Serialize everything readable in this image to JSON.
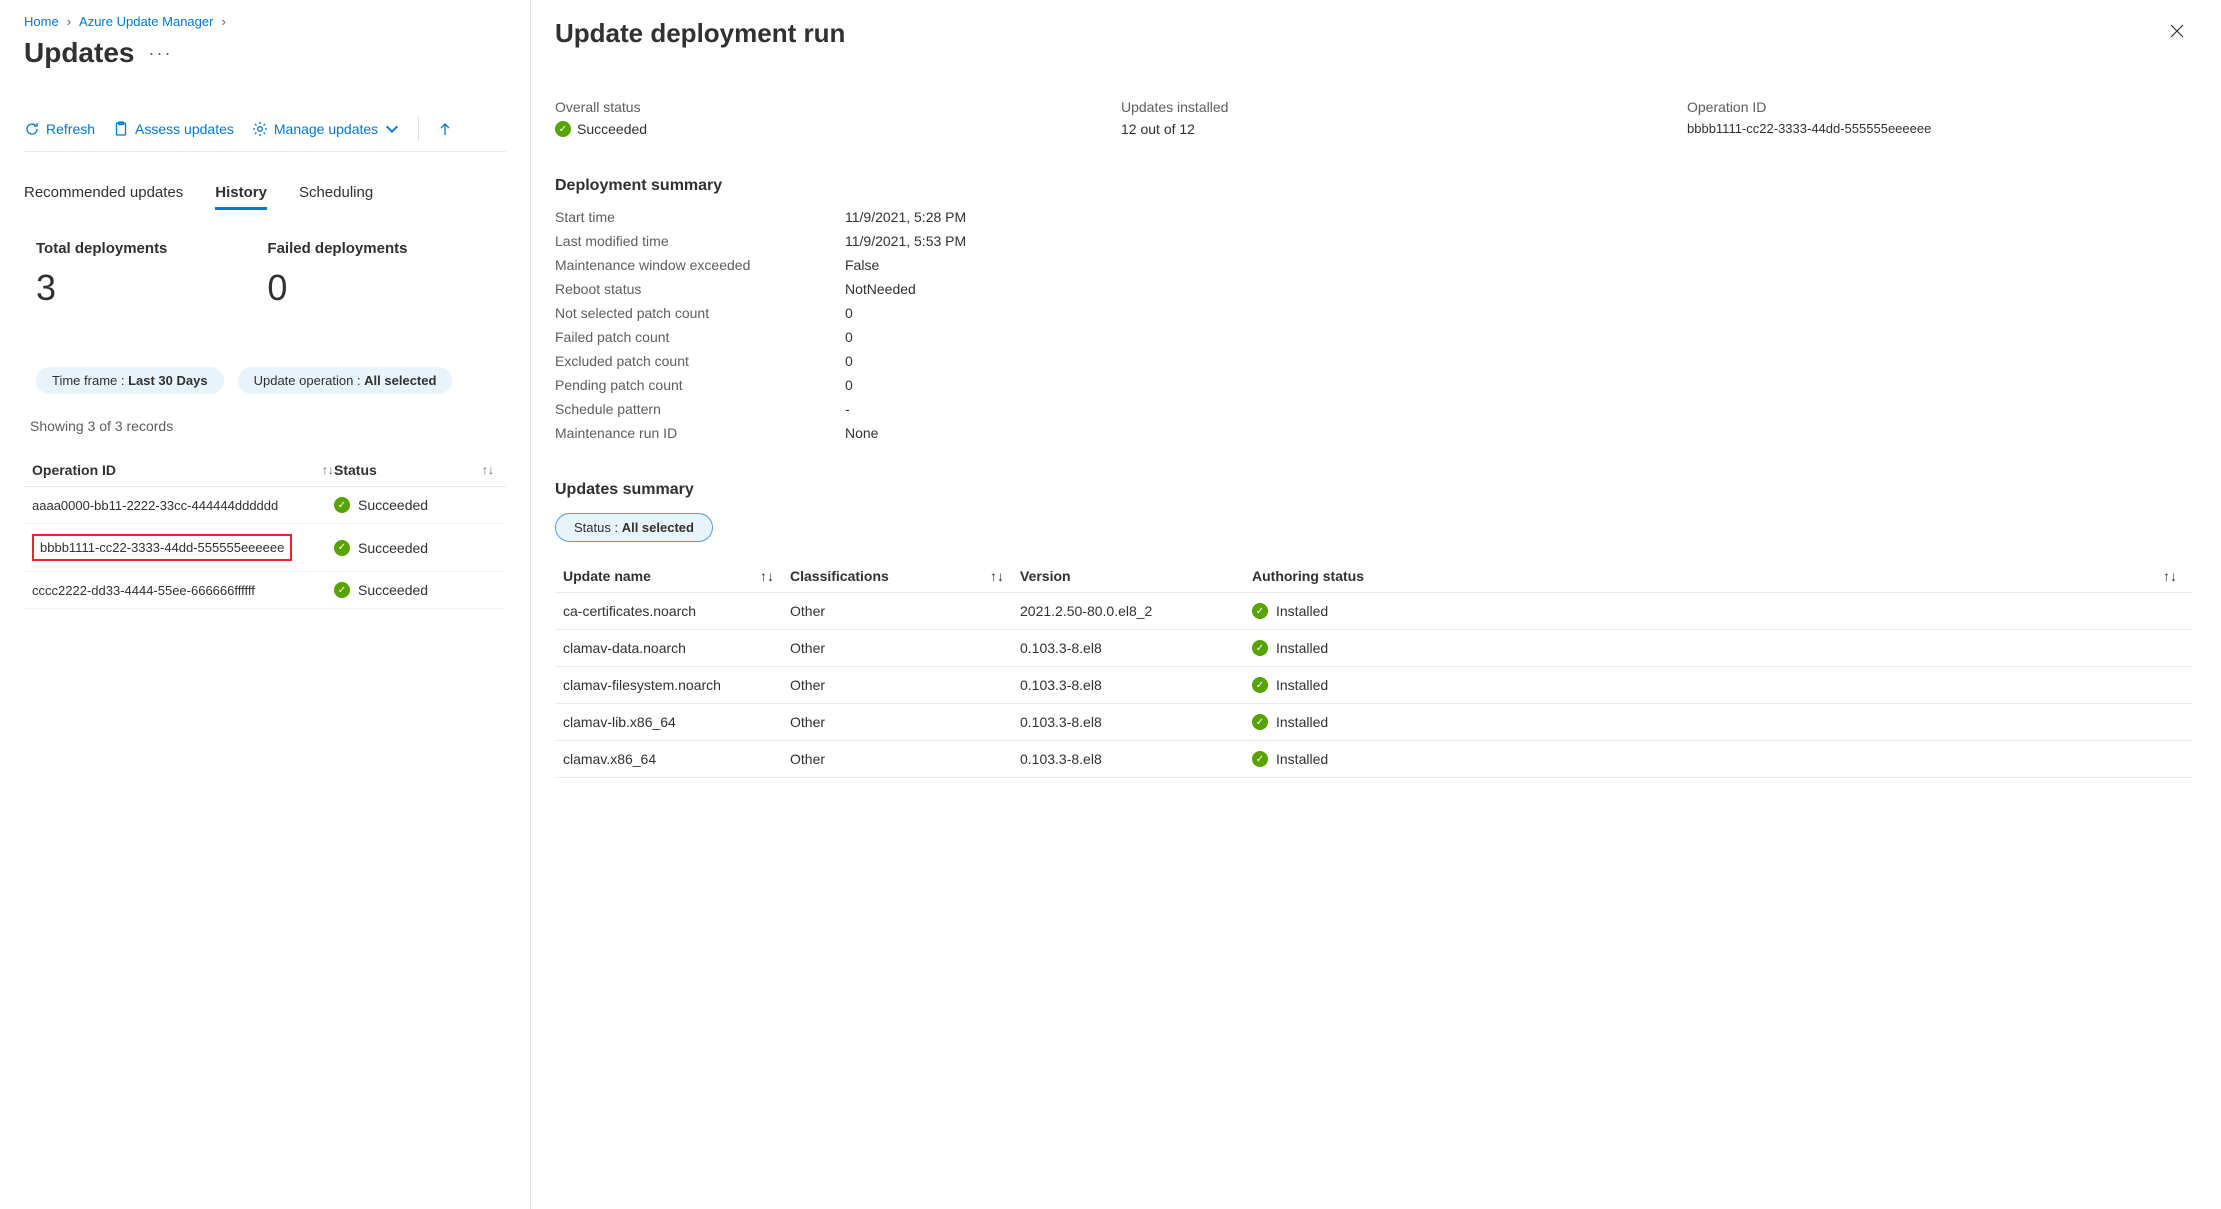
{
  "breadcrumb": {
    "home": "Home",
    "service": "Azure Update Manager"
  },
  "page_title": "Updates",
  "toolbar": {
    "refresh": "Refresh",
    "assess": "Assess updates",
    "manage": "Manage updates"
  },
  "tabs": {
    "recommended": "Recommended updates",
    "history": "History",
    "scheduling": "Scheduling"
  },
  "kpis": {
    "total_label": "Total deployments",
    "total_value": "3",
    "failed_label": "Failed deployments",
    "failed_value": "0"
  },
  "filters": {
    "time_label": "Time frame : ",
    "time_value": "Last 30 Days",
    "op_label": "Update operation : ",
    "op_value": "All selected"
  },
  "records_count": "Showing 3 of 3 records",
  "table": {
    "head_op": "Operation ID",
    "head_status": "Status",
    "rows": [
      {
        "id": "aaaa0000-bb11-2222-33cc-444444dddddd",
        "status": "Succeeded",
        "highlight": false
      },
      {
        "id": "bbbb1111-cc22-3333-44dd-555555eeeeee",
        "status": "Succeeded",
        "highlight": true
      },
      {
        "id": "cccc2222-dd33-4444-55ee-666666ffffff",
        "status": "Succeeded",
        "highlight": false
      }
    ]
  },
  "flyout": {
    "title": "Update deployment run",
    "overall_label": "Overall status",
    "overall_value": "Succeeded",
    "installed_label": "Updates installed",
    "installed_value": "12 out of 12",
    "opid_label": "Operation ID",
    "opid_value": "bbbb1111-cc22-3333-44dd-555555eeeeee",
    "summary_title": "Deployment summary",
    "summary": [
      {
        "k": "Start time",
        "v": "11/9/2021, 5:28 PM"
      },
      {
        "k": "Last modified time",
        "v": "11/9/2021, 5:53 PM"
      },
      {
        "k": "Maintenance window exceeded",
        "v": "False"
      },
      {
        "k": "Reboot status",
        "v": "NotNeeded"
      },
      {
        "k": "Not selected patch count",
        "v": "0"
      },
      {
        "k": "Failed patch count",
        "v": "0"
      },
      {
        "k": "Excluded patch count",
        "v": "0"
      },
      {
        "k": "Pending patch count",
        "v": "0"
      },
      {
        "k": "Schedule pattern",
        "v": "-"
      },
      {
        "k": "Maintenance run ID",
        "v": "None"
      }
    ],
    "updates_title": "Updates summary",
    "status_filter_label": "Status : ",
    "status_filter_value": "All selected",
    "ut_head": {
      "name": "Update name",
      "class": "Classifications",
      "ver": "Version",
      "auth": "Authoring status"
    },
    "ut_rows": [
      {
        "name": "ca-certificates.noarch",
        "class": "Other",
        "ver": "2021.2.50-80.0.el8_2",
        "auth": "Installed"
      },
      {
        "name": "clamav-data.noarch",
        "class": "Other",
        "ver": "0.103.3-8.el8",
        "auth": "Installed"
      },
      {
        "name": "clamav-filesystem.noarch",
        "class": "Other",
        "ver": "0.103.3-8.el8",
        "auth": "Installed"
      },
      {
        "name": "clamav-lib.x86_64",
        "class": "Other",
        "ver": "0.103.3-8.el8",
        "auth": "Installed"
      },
      {
        "name": "clamav.x86_64",
        "class": "Other",
        "ver": "0.103.3-8.el8",
        "auth": "Installed"
      }
    ]
  }
}
